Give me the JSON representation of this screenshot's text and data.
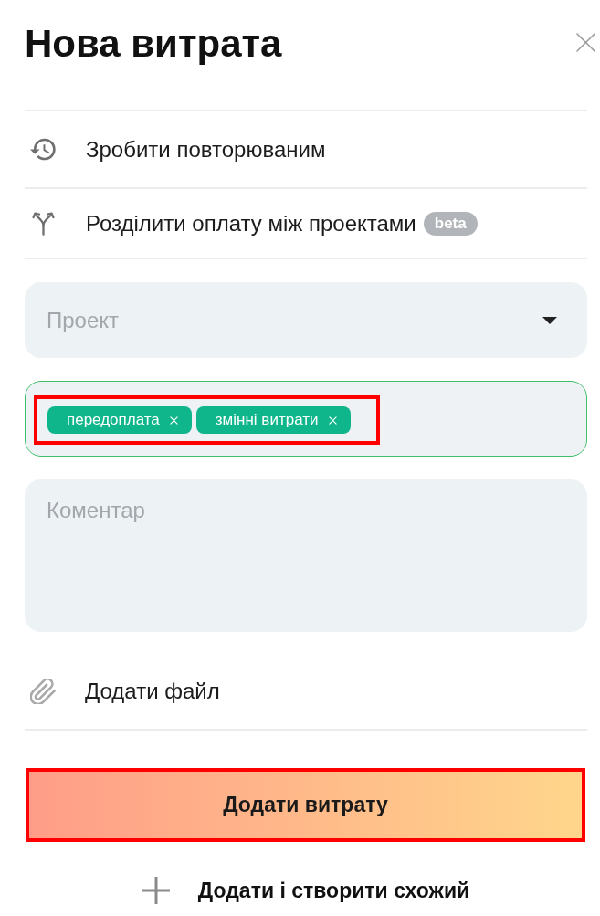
{
  "header": {
    "title": "Нова витрата"
  },
  "options": [
    {
      "kind": "recurring",
      "label": "Зробити повторюваним"
    },
    {
      "kind": "split",
      "label": "Розділити оплату між проектами",
      "badge": "beta"
    }
  ],
  "project_select": {
    "placeholder": "Проект"
  },
  "tags_field": {
    "focused": true,
    "highlighted": true,
    "tags": [
      {
        "label": "передоплата"
      },
      {
        "label": "змінні витрати"
      }
    ]
  },
  "comment": {
    "placeholder": "Коментар"
  },
  "attachment": {
    "label": "Додати файл"
  },
  "submit": {
    "label": "Додати витрату",
    "highlighted": true
  },
  "secondary": {
    "label": "Додати і створити схожий"
  }
}
